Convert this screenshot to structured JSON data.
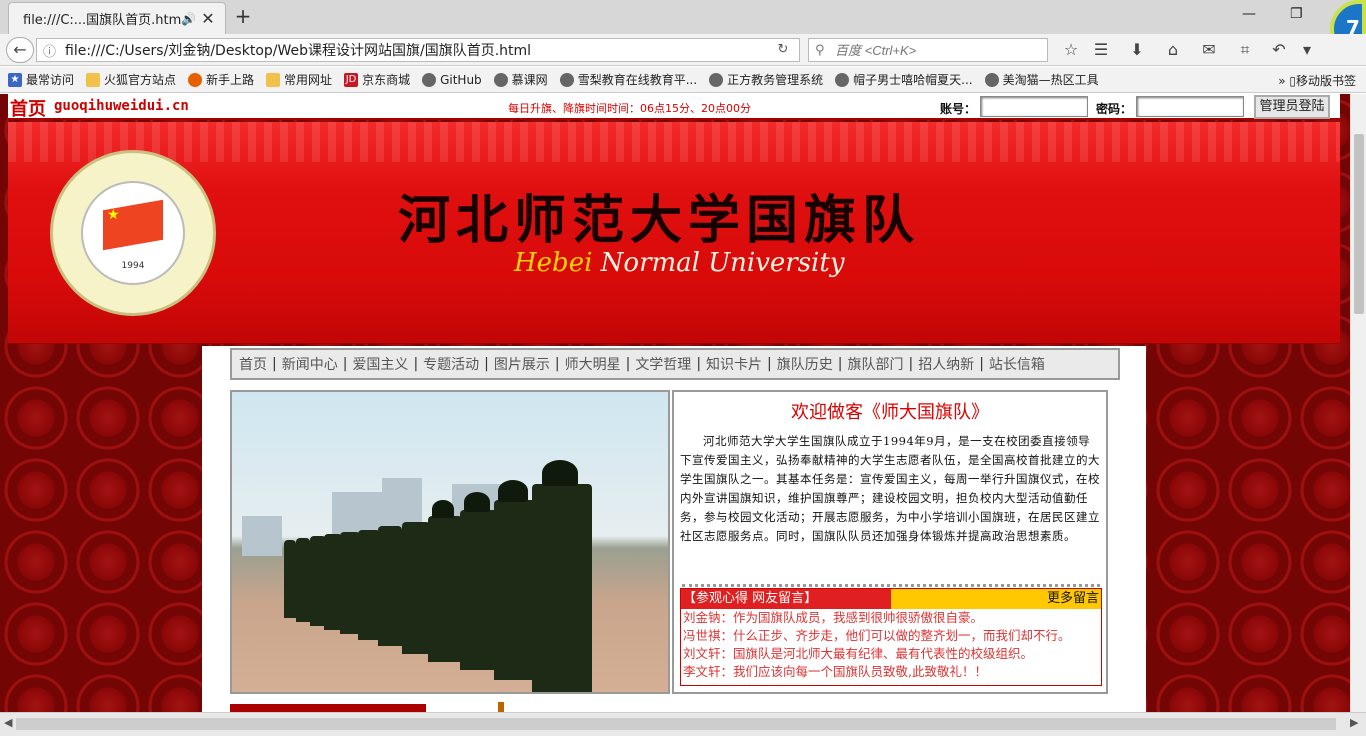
{
  "browser": {
    "tab_title": "file:///C:...国旗队首页.html",
    "tab_audio_icon": "🔊",
    "tab_close": "✕",
    "new_tab": "+",
    "url": "file:///C:/Users/刘金钠/Desktop/Web课程设计网站国旗/国旗队首页.html",
    "search_placeholder": "百度 <Ctrl+K>",
    "extension_badge": "7",
    "bookmarks": [
      "最常访问",
      "火狐官方站点",
      "新手上路",
      "常用网址",
      "京东商城",
      "GitHub",
      "慕课网",
      "雪梨教育在线教育平...",
      "正方教务管理系统",
      "帽子男士嘻哈帽夏天...",
      "美淘猫—热区工具"
    ],
    "bookmark_icons": [
      "star-icon",
      "folder-icon",
      "firefox-icon",
      "folder-icon",
      "jd-icon",
      "globe-icon",
      "globe-icon",
      "globe-icon",
      "globe-icon",
      "globe-icon",
      "globe-icon"
    ],
    "mobile_bookmarks": "移动版书签",
    "more": "»"
  },
  "site": {
    "home_title": "首页",
    "domain": "guoqihuweidui.cn",
    "flag_times": "每日升旗、降旗时间时间：06点15分、20点00分",
    "account_label": "账号：",
    "password_label": "密码：",
    "login_button": "管理员登陆",
    "cn_title": "河北师范大学国旗队",
    "en_title_hebei": "Hebei",
    "en_title_rest": " Normal University",
    "emblem_year": "1994",
    "nav": [
      "首页",
      "新闻中心",
      "爱国主义",
      "专题活动",
      "图片展示",
      "师大明星",
      "文学哲理",
      "知识卡片",
      "旗队历史",
      "旗队部门",
      "招人纳新",
      "站长信箱"
    ],
    "nav_sep": "|",
    "welcome": "欢迎做客《师大国旗队》",
    "intro": "河北师范大学大学生国旗队成立于1994年9月，是一支在校团委直接领导下宣传爱国主义，弘扬奉献精神的大学生志愿者队伍，是全国高校首批建立的大学生国旗队之一。其基本任务是：宣传爱国主义，每周一举行升国旗仪式，在校内外宣讲国旗知识，维护国旗尊严；建设校园文明，担负校内大型活动值勤任务，参与校园文化活动；开展志愿服务，为中小学培训小国旗班，在居民区建立社区志愿服务点。同时，国旗队队员还加强身体锻炼并提高政治思想素质。",
    "messages_title": "【参观心得  网友留言】",
    "more_messages": "更多留言",
    "messages": [
      "刘金钠：作为国旗队成员，我感到很帅很骄傲很自豪。",
      "冯世祺：什么正步、齐步走，他们可以做的整齐划一，而我们却不行。",
      "刘文轩：国旗队是河北师大最有纪律、最有代表性的校级组织。",
      "李文轩：我们应该向每一个国旗队员致敬,此致敬礼！！"
    ]
  },
  "colors": {
    "accent_red": "#d00000",
    "banner_red": "#e01010",
    "gold": "#ffd200",
    "background_red": "#740505"
  }
}
